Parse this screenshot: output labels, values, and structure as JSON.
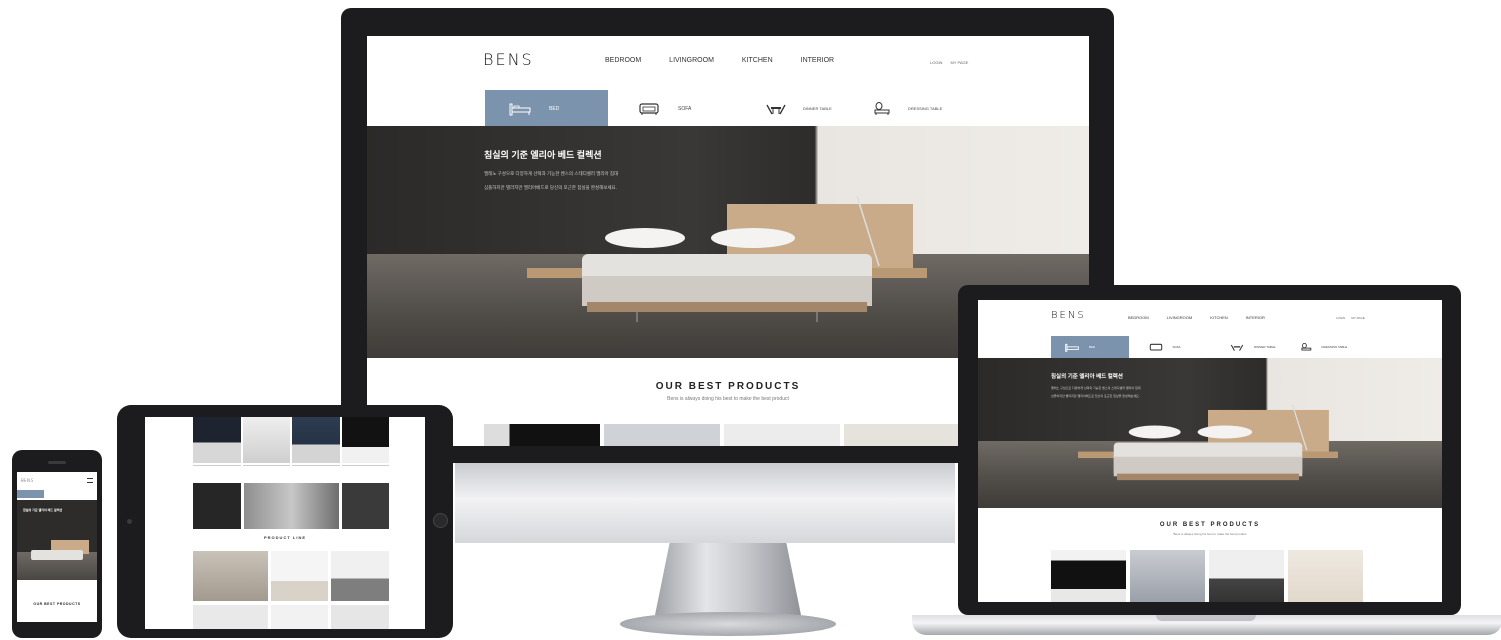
{
  "site": {
    "logo": "BENS",
    "nav": [
      "BEDROOM",
      "LIVINGROOM",
      "KITCHEN",
      "INTERIOR"
    ],
    "util": [
      "LOGIN",
      "MY PAGE"
    ],
    "categories": [
      {
        "label": "BED",
        "icon": "bed-icon",
        "active": true
      },
      {
        "label": "SOFA",
        "icon": "sofa-icon",
        "active": false
      },
      {
        "label": "DINNER TABLE",
        "icon": "dinner-table-icon",
        "active": false
      },
      {
        "label": "DRESSING TABLE",
        "icon": "dressing-table-icon",
        "active": false
      }
    ],
    "hero": {
      "title": "침실의 기준 엘리아 베드 컬렉션",
      "line1": "엘레노 구성으로 다양하게 선택과 기능한 벤스의 스테디셀러 엘리아 침대",
      "line2": "심플하지만 별라지만 엘리아베드로 당신의 포근한 침실을 완성해보세요."
    },
    "best": {
      "title": "OUR BEST PRODUCTS",
      "subtitle": "Bens is always doing his best to make the best product"
    }
  },
  "tablet": {
    "section_title": "PRODUCT LINE"
  },
  "colors": {
    "bezel": "#1c1c1e",
    "accent": "#7c93ad",
    "hero_dark": "#2b2a29"
  }
}
